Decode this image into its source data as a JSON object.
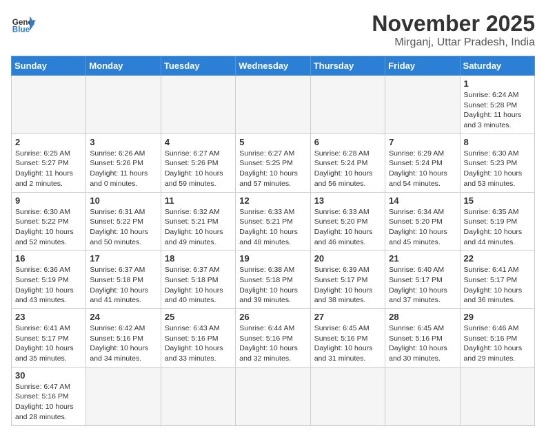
{
  "header": {
    "logo_general": "General",
    "logo_blue": "Blue",
    "month_title": "November 2025",
    "location": "Mirganj, Uttar Pradesh, India"
  },
  "days": [
    "Sunday",
    "Monday",
    "Tuesday",
    "Wednesday",
    "Thursday",
    "Friday",
    "Saturday"
  ],
  "weeks": [
    [
      {
        "date": "",
        "empty": true
      },
      {
        "date": "",
        "empty": true
      },
      {
        "date": "",
        "empty": true
      },
      {
        "date": "",
        "empty": true
      },
      {
        "date": "",
        "empty": true
      },
      {
        "date": "",
        "empty": true
      },
      {
        "date": "1",
        "sunrise": "Sunrise: 6:24 AM",
        "sunset": "Sunset: 5:28 PM",
        "daylight": "Daylight: 11 hours and 3 minutes."
      }
    ],
    [
      {
        "date": "2",
        "sunrise": "Sunrise: 6:25 AM",
        "sunset": "Sunset: 5:27 PM",
        "daylight": "Daylight: 11 hours and 2 minutes."
      },
      {
        "date": "3",
        "sunrise": "Sunrise: 6:26 AM",
        "sunset": "Sunset: 5:26 PM",
        "daylight": "Daylight: 11 hours and 0 minutes."
      },
      {
        "date": "4",
        "sunrise": "Sunrise: 6:27 AM",
        "sunset": "Sunset: 5:26 PM",
        "daylight": "Daylight: 10 hours and 59 minutes."
      },
      {
        "date": "5",
        "sunrise": "Sunrise: 6:27 AM",
        "sunset": "Sunset: 5:25 PM",
        "daylight": "Daylight: 10 hours and 57 minutes."
      },
      {
        "date": "6",
        "sunrise": "Sunrise: 6:28 AM",
        "sunset": "Sunset: 5:24 PM",
        "daylight": "Daylight: 10 hours and 56 minutes."
      },
      {
        "date": "7",
        "sunrise": "Sunrise: 6:29 AM",
        "sunset": "Sunset: 5:24 PM",
        "daylight": "Daylight: 10 hours and 54 minutes."
      },
      {
        "date": "8",
        "sunrise": "Sunrise: 6:30 AM",
        "sunset": "Sunset: 5:23 PM",
        "daylight": "Daylight: 10 hours and 53 minutes."
      }
    ],
    [
      {
        "date": "9",
        "sunrise": "Sunrise: 6:30 AM",
        "sunset": "Sunset: 5:22 PM",
        "daylight": "Daylight: 10 hours and 52 minutes."
      },
      {
        "date": "10",
        "sunrise": "Sunrise: 6:31 AM",
        "sunset": "Sunset: 5:22 PM",
        "daylight": "Daylight: 10 hours and 50 minutes."
      },
      {
        "date": "11",
        "sunrise": "Sunrise: 6:32 AM",
        "sunset": "Sunset: 5:21 PM",
        "daylight": "Daylight: 10 hours and 49 minutes."
      },
      {
        "date": "12",
        "sunrise": "Sunrise: 6:33 AM",
        "sunset": "Sunset: 5:21 PM",
        "daylight": "Daylight: 10 hours and 48 minutes."
      },
      {
        "date": "13",
        "sunrise": "Sunrise: 6:33 AM",
        "sunset": "Sunset: 5:20 PM",
        "daylight": "Daylight: 10 hours and 46 minutes."
      },
      {
        "date": "14",
        "sunrise": "Sunrise: 6:34 AM",
        "sunset": "Sunset: 5:20 PM",
        "daylight": "Daylight: 10 hours and 45 minutes."
      },
      {
        "date": "15",
        "sunrise": "Sunrise: 6:35 AM",
        "sunset": "Sunset: 5:19 PM",
        "daylight": "Daylight: 10 hours and 44 minutes."
      }
    ],
    [
      {
        "date": "16",
        "sunrise": "Sunrise: 6:36 AM",
        "sunset": "Sunset: 5:19 PM",
        "daylight": "Daylight: 10 hours and 43 minutes."
      },
      {
        "date": "17",
        "sunrise": "Sunrise: 6:37 AM",
        "sunset": "Sunset: 5:18 PM",
        "daylight": "Daylight: 10 hours and 41 minutes."
      },
      {
        "date": "18",
        "sunrise": "Sunrise: 6:37 AM",
        "sunset": "Sunset: 5:18 PM",
        "daylight": "Daylight: 10 hours and 40 minutes."
      },
      {
        "date": "19",
        "sunrise": "Sunrise: 6:38 AM",
        "sunset": "Sunset: 5:18 PM",
        "daylight": "Daylight: 10 hours and 39 minutes."
      },
      {
        "date": "20",
        "sunrise": "Sunrise: 6:39 AM",
        "sunset": "Sunset: 5:17 PM",
        "daylight": "Daylight: 10 hours and 38 minutes."
      },
      {
        "date": "21",
        "sunrise": "Sunrise: 6:40 AM",
        "sunset": "Sunset: 5:17 PM",
        "daylight": "Daylight: 10 hours and 37 minutes."
      },
      {
        "date": "22",
        "sunrise": "Sunrise: 6:41 AM",
        "sunset": "Sunset: 5:17 PM",
        "daylight": "Daylight: 10 hours and 36 minutes."
      }
    ],
    [
      {
        "date": "23",
        "sunrise": "Sunrise: 6:41 AM",
        "sunset": "Sunset: 5:17 PM",
        "daylight": "Daylight: 10 hours and 35 minutes."
      },
      {
        "date": "24",
        "sunrise": "Sunrise: 6:42 AM",
        "sunset": "Sunset: 5:16 PM",
        "daylight": "Daylight: 10 hours and 34 minutes."
      },
      {
        "date": "25",
        "sunrise": "Sunrise: 6:43 AM",
        "sunset": "Sunset: 5:16 PM",
        "daylight": "Daylight: 10 hours and 33 minutes."
      },
      {
        "date": "26",
        "sunrise": "Sunrise: 6:44 AM",
        "sunset": "Sunset: 5:16 PM",
        "daylight": "Daylight: 10 hours and 32 minutes."
      },
      {
        "date": "27",
        "sunrise": "Sunrise: 6:45 AM",
        "sunset": "Sunset: 5:16 PM",
        "daylight": "Daylight: 10 hours and 31 minutes."
      },
      {
        "date": "28",
        "sunrise": "Sunrise: 6:45 AM",
        "sunset": "Sunset: 5:16 PM",
        "daylight": "Daylight: 10 hours and 30 minutes."
      },
      {
        "date": "29",
        "sunrise": "Sunrise: 6:46 AM",
        "sunset": "Sunset: 5:16 PM",
        "daylight": "Daylight: 10 hours and 29 minutes."
      }
    ],
    [
      {
        "date": "30",
        "sunrise": "Sunrise: 6:47 AM",
        "sunset": "Sunset: 5:16 PM",
        "daylight": "Daylight: 10 hours and 28 minutes."
      },
      {
        "date": "",
        "empty": true
      },
      {
        "date": "",
        "empty": true
      },
      {
        "date": "",
        "empty": true
      },
      {
        "date": "",
        "empty": true
      },
      {
        "date": "",
        "empty": true
      },
      {
        "date": "",
        "empty": true
      }
    ]
  ]
}
